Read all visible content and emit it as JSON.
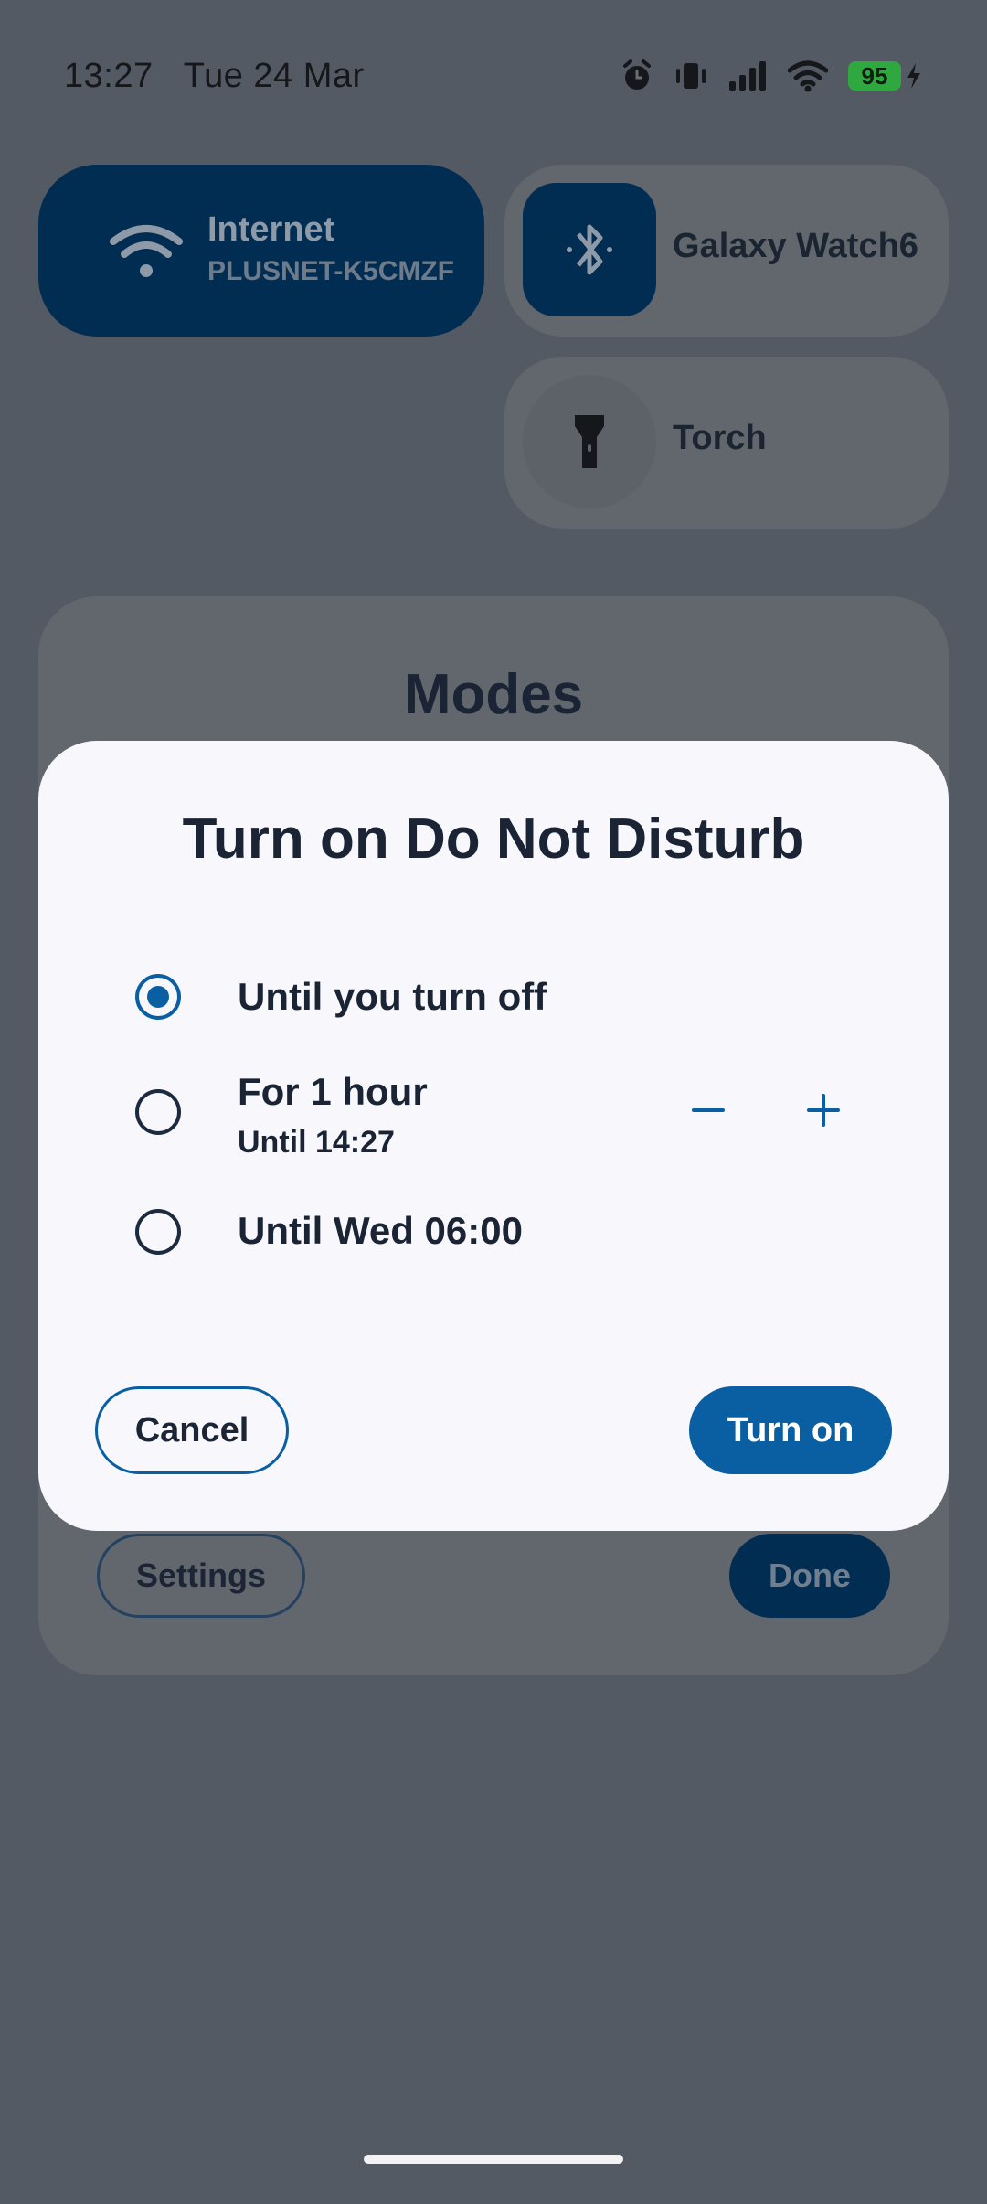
{
  "status_bar": {
    "time": "13:27",
    "date": "Tue 24 Mar",
    "battery": "95",
    "icons": [
      "alarm-icon",
      "vibrate-icon",
      "cell-signal-icon",
      "wifi-icon",
      "battery-icon",
      "charging-icon"
    ]
  },
  "quick_settings": {
    "internet": {
      "title": "Internet",
      "subtitle": "PLUSNET-K5CMZF",
      "icon": "wifi-icon"
    },
    "bluetooth": {
      "title": "Galaxy Watch6",
      "icon": "bluetooth-icon"
    },
    "torch": {
      "title": "Torch",
      "icon": "flashlight-icon"
    }
  },
  "modes_sheet": {
    "title": "Modes",
    "settings_label": "Settings",
    "done_label": "Done"
  },
  "dialog": {
    "title": "Turn on Do Not Disturb",
    "options": [
      {
        "label": "Until you turn off",
        "selected": true
      },
      {
        "label": "For 1 hour",
        "sublabel": "Until 14:27",
        "selected": false
      },
      {
        "label": "Until Wed 06:00",
        "selected": false
      }
    ],
    "cancel_label": "Cancel",
    "turn_on_label": "Turn on"
  },
  "colors": {
    "accent": "#0a5fa3",
    "tile_active": "#022d52",
    "scrim": "#545a63",
    "dialog_bg": "#f8f8fc"
  }
}
